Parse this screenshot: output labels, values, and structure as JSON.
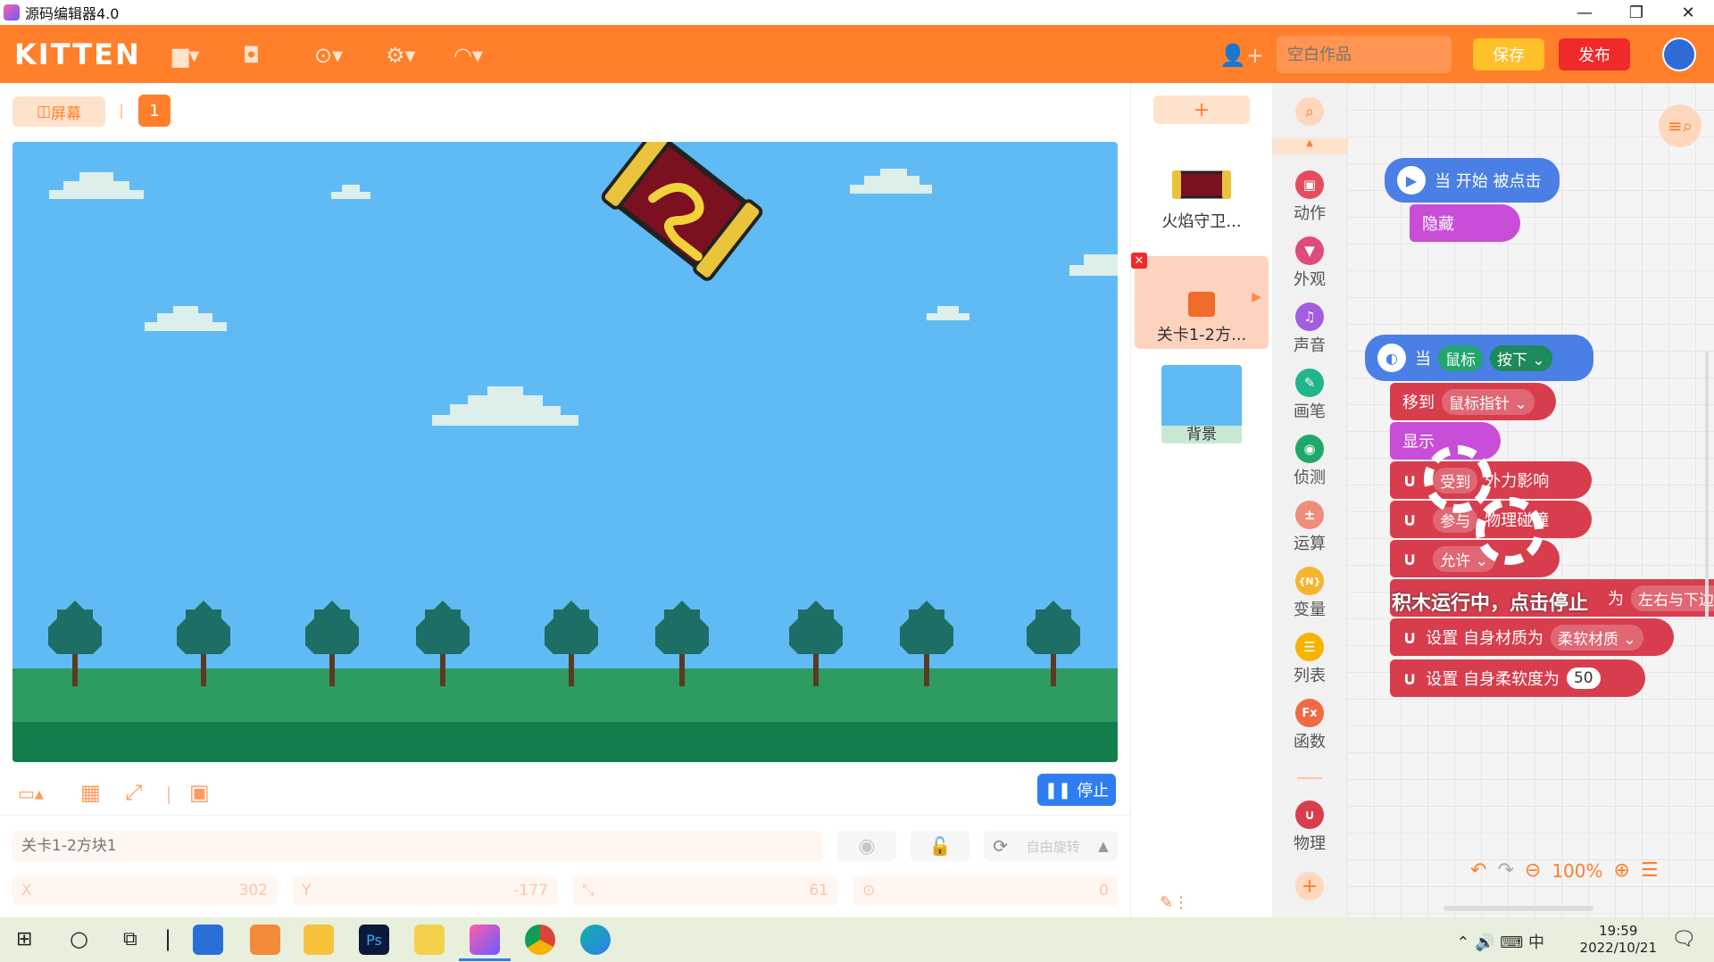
{
  "window": {
    "title": "源码编辑器4.0",
    "minimize": "—",
    "restore": "❐",
    "close": "✕"
  },
  "topbar": {
    "logo": "KITTEN",
    "icons": [
      "folder-icon",
      "backpack-icon",
      "help-icon",
      "settings-icon",
      "wifi-icon"
    ],
    "project_placeholder": "空白作品",
    "save_label": "保存",
    "publish_label": "发布"
  },
  "stage_header": {
    "screen_label": "屏幕",
    "scene_number": "1"
  },
  "stage_controls": {
    "stop_label": "停止"
  },
  "properties": {
    "name_placeholder": "关卡1-2方块1",
    "rotation_label": "自由旋转",
    "x_label": "X",
    "x_value": "302",
    "y_label": "Y",
    "y_value": "-177",
    "size_value": "61",
    "direction_value": "0"
  },
  "sprites": {
    "add_label": "+",
    "items": [
      {
        "name": "火焰守卫..."
      },
      {
        "name": "关卡1-2方..."
      },
      {
        "name": "背景"
      }
    ]
  },
  "categories": [
    {
      "label": "动作",
      "color": "#e64b5e"
    },
    {
      "label": "外观",
      "color": "#e04a7d"
    },
    {
      "label": "声音",
      "color": "#a25de0"
    },
    {
      "label": "画笔",
      "color": "#20b58a"
    },
    {
      "label": "侦测",
      "color": "#1ea96a"
    },
    {
      "label": "运算",
      "color": "#f08c7a"
    },
    {
      "label": "变量",
      "color": "#f5b52e"
    },
    {
      "label": "列表",
      "color": "#f6b300"
    },
    {
      "label": "函数",
      "color": "#f06a45"
    },
    {
      "label": "物理",
      "color": "#d83d4d"
    }
  ],
  "blocks": {
    "start_event": "当 开始 被点击",
    "hide": "隐藏",
    "when": "当",
    "mouse": "鼠标",
    "pressed": "按下",
    "move_to": "移到",
    "mouse_pointer": "鼠标指针",
    "show": "显示",
    "receive": "受到",
    "external_force": "外力影响",
    "participate": "参与",
    "physics_collision": "物理碰撞",
    "allow": "允许",
    "running_overlay": "积木运行中，点击停止",
    "set_as": "为",
    "left_right_bottom": "左右与下边缘",
    "set_material": "设置 自身材质为",
    "soft_material": "柔软材质",
    "set_softness": "设置 自身柔软度为",
    "softness_value": "50",
    "zoom": "100%"
  },
  "clock": {
    "time": "19:59",
    "date": "2022/10/21"
  }
}
